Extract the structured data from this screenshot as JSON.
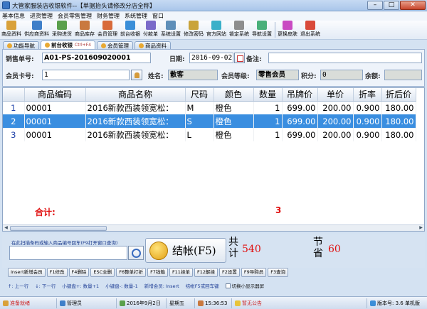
{
  "window": {
    "title": "大管家服装店收银软件--【单据抬头请修改分店全称】"
  },
  "menu": [
    "基本信息",
    "进货管理",
    "会员零售管理",
    "财务管理",
    "系统管理",
    "窗口"
  ],
  "toolbar": [
    {
      "label": "商品资料",
      "icon": "product-icon",
      "color": "#d9a13a"
    },
    {
      "label": "供应商资料",
      "icon": "supplier-icon",
      "color": "#3f7fc9"
    },
    {
      "label": "采购进货",
      "icon": "purchase-icon",
      "color": "#5aa04c"
    },
    {
      "label": "商品库存",
      "icon": "stock-icon",
      "color": "#c9793f"
    },
    {
      "label": "会员管理",
      "icon": "member-icon",
      "color": "#d86a3a"
    },
    {
      "label": "前台收银",
      "icon": "cashier-icon",
      "color": "#3a8ed8"
    },
    {
      "label": "付款单",
      "icon": "payment-icon",
      "color": "#7a6ac9"
    },
    {
      "label": "系统设置",
      "icon": "settings-icon",
      "color": "#5f8fb9"
    },
    {
      "label": "修改密码",
      "icon": "key-icon",
      "color": "#c9a33a"
    },
    {
      "label": "官方网站",
      "icon": "globe-icon",
      "color": "#3ab0c9"
    },
    {
      "label": "锁定系统",
      "icon": "lock-icon",
      "color": "#8e8e8e"
    },
    {
      "label": "导航设置",
      "icon": "navigation-icon",
      "color": "#4ab07a"
    },
    {
      "label": "更换皮肤",
      "icon": "skin-icon",
      "color": "#c94ac2"
    },
    {
      "label": "退出系统",
      "icon": "exit-icon",
      "color": "#d94a3a"
    }
  ],
  "tabs": [
    {
      "label": "功能导航",
      "active": false
    },
    {
      "label": "前台收银",
      "active": true,
      "close": "Ctrl+F4"
    },
    {
      "label": "会员管理",
      "active": false
    },
    {
      "label": "商品资料",
      "active": false
    }
  ],
  "form": {
    "order_label": "销售单号:",
    "order_no": "A01-PS-201609020001",
    "date_label": "日期:",
    "date": "2016-09-02",
    "remark_label": "备注:",
    "remark": "",
    "card_label": "会员卡号:",
    "card_no": "1",
    "name_label": "姓名:",
    "name": "散客",
    "level_label": "会员等级:",
    "level": "零售会员",
    "points_label": "积分:",
    "points": "0",
    "balance_label": "余额:",
    "balance": ""
  },
  "table": {
    "headers": [
      "",
      "商品编码",
      "商品名称",
      "尺码",
      "颜色",
      "数量",
      "吊牌价",
      "单价",
      "折率",
      "折后价"
    ],
    "rows": [
      [
        "1",
        "00001",
        "2016新款西装领宽松：",
        "M",
        "橙色",
        "1",
        "699.00",
        "200.00",
        "0.900",
        "180.00"
      ],
      [
        "2",
        "00001",
        "2016新款西装领宽松：",
        "S",
        "橙色",
        "1",
        "699.00",
        "200.00",
        "0.900",
        "180.00"
      ],
      [
        "3",
        "00001",
        "2016新款西装领宽松：",
        "L",
        "橙色",
        "1",
        "699.00",
        "200.00",
        "0.900",
        "180.00"
      ]
    ],
    "selected_row": 1,
    "total_label": "合计:",
    "total_qty": "3"
  },
  "checkout": {
    "scan_hint": "在此扫描条码或输入商品编号回车(F9打开窗口查询)",
    "scan_value": "",
    "button_label": "结帐(F5)",
    "sum_label": "共计",
    "sum_value": "540",
    "save_label": "节省",
    "save_value": "60"
  },
  "fkeys": [
    "Insert新增会员",
    "F1修改",
    "F4删除",
    "ESC全删",
    "F6整单打折",
    "F7钱箱",
    "F11挂单",
    "F12解挂",
    "F2设置",
    "F9导购员",
    "F3查询"
  ],
  "hints": [
    "↑: 上一行",
    "↓: 下一行",
    "小键盘+: 数量+1",
    "小键盘-: 数量-1",
    "新增会员: Insert",
    "结帐F5或回车键"
  ],
  "hint_checkbox": "切换小显示器屏",
  "status": {
    "state": "准备就绪",
    "user": "管理员",
    "date": "2016年9月2日",
    "weekday": "星期五",
    "time": "15:36:53",
    "notice": "暂无公告",
    "version": "版本号: 3.6 单机版"
  },
  "colors": {
    "accent": "#3a8ee0",
    "highlight": "#e01010"
  }
}
